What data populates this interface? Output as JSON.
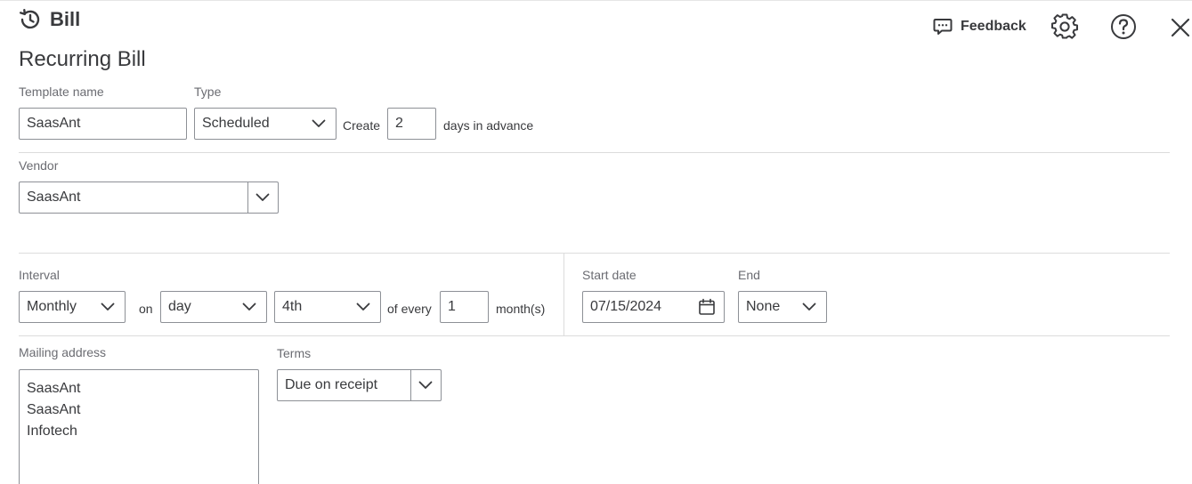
{
  "header": {
    "title": "Bill",
    "history_icon": "history-icon",
    "feedback_label": "Feedback",
    "feedback_icon": "chat-bubble-icon",
    "settings_icon": "gear-icon",
    "help_icon": "help-icon",
    "close_icon": "close-icon"
  },
  "form": {
    "heading": "Recurring Bill",
    "template_name": {
      "label": "Template name",
      "value": "SaasAnt"
    },
    "type": {
      "label": "Type",
      "value": "Scheduled"
    },
    "create": {
      "prefix": "Create",
      "value": "2",
      "suffix": "days in advance"
    },
    "vendor": {
      "label": "Vendor",
      "value": "SaasAnt"
    },
    "interval": {
      "label": "Interval",
      "frequency": "Monthly",
      "on_label": "on",
      "day_type": "day",
      "day_value": "4th",
      "of_every_label": "of every",
      "every_value": "1",
      "unit_label": "month(s)"
    },
    "start_date": {
      "label": "Start date",
      "value": "07/15/2024",
      "icon": "calendar-icon"
    },
    "end": {
      "label": "End",
      "value": "None"
    },
    "mailing_address": {
      "label": "Mailing address",
      "lines": [
        "SaasAnt",
        "SaasAnt",
        "Infotech"
      ]
    },
    "terms": {
      "label": "Terms",
      "value": "Due on receipt"
    }
  }
}
